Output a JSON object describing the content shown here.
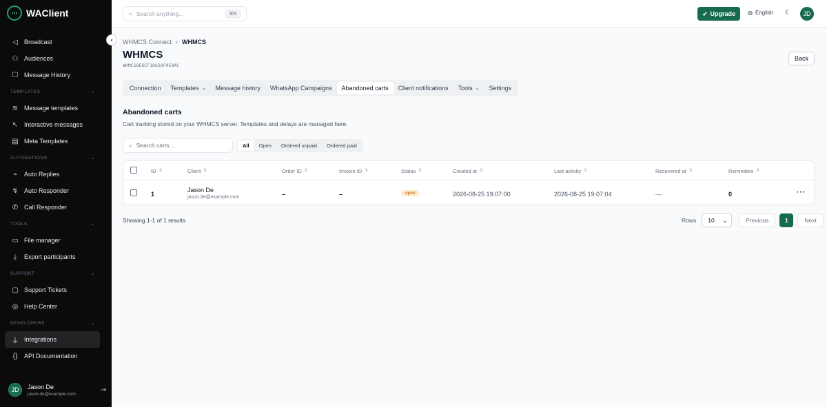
{
  "app": {
    "name": "WAClient"
  },
  "sidebar": {
    "items_top": [
      {
        "label": "Broadcast",
        "icon": "megaphone-icon"
      },
      {
        "label": "Audiences",
        "icon": "users-icon"
      },
      {
        "label": "Message History",
        "icon": "history-icon"
      }
    ],
    "sections": [
      {
        "label": "TEMPLATES",
        "items": [
          {
            "label": "Message templates",
            "icon": "layers-icon"
          },
          {
            "label": "Interactive messages",
            "icon": "cursor-icon"
          },
          {
            "label": "Meta Templates",
            "icon": "template-icon"
          }
        ]
      },
      {
        "label": "AUTOMATIONS",
        "items": [
          {
            "label": "Auto Replies",
            "icon": "reply-icon"
          },
          {
            "label": "Auto Responder",
            "icon": "responder-icon"
          },
          {
            "label": "Call Responder",
            "icon": "phone-icon"
          }
        ]
      },
      {
        "label": "TOOLS",
        "items": [
          {
            "label": "File manager",
            "icon": "folder-icon"
          },
          {
            "label": "Export participants",
            "icon": "download-icon"
          }
        ]
      },
      {
        "label": "SUPPORT",
        "items": [
          {
            "label": "Support Tickets",
            "icon": "ticket-icon"
          },
          {
            "label": "Help Center",
            "icon": "lifebuoy-icon"
          }
        ]
      },
      {
        "label": "DEVELOPERS",
        "items": [
          {
            "label": "Integrations",
            "icon": "plug-icon",
            "active": true
          },
          {
            "label": "API Documentation",
            "icon": "braces-icon"
          }
        ]
      }
    ],
    "user": {
      "initials": "JD",
      "name": "Jason De",
      "email": "jason.de@example.com"
    }
  },
  "topbar": {
    "search_placeholder": "Search anything...",
    "search_shortcut": "⌘K",
    "upgrade_label": "Upgrade",
    "language": "English",
    "avatar_initials": "JD"
  },
  "page": {
    "breadcrumb": [
      "WHMCS Connect",
      "WHMCS"
    ],
    "title": "WHMCS",
    "id": "WHMCS8E6EF18628F0E8AC",
    "back_label": "Back",
    "tabs": [
      {
        "label": "Connection"
      },
      {
        "label": "Templates",
        "dropdown": true
      },
      {
        "label": "Message history"
      },
      {
        "label": "WhatsApp Campaigns"
      },
      {
        "label": "Abandoned carts",
        "active": true
      },
      {
        "label": "Client notifications"
      },
      {
        "label": "Tools",
        "dropdown": true
      },
      {
        "label": "Settings"
      }
    ],
    "section_title": "Abandoned carts",
    "section_desc": "Cart tracking stored on your WHMCS server. Templates and delays are managed here.",
    "search_placeholder": "Search carts...",
    "filters": [
      "All",
      "Open",
      "Ordered unpaid",
      "Ordered paid"
    ],
    "table": {
      "columns": [
        "ID",
        "Client",
        "Order ID",
        "Invoice ID",
        "Status",
        "Created at",
        "Last activity",
        "Recovered at",
        "Reminders"
      ],
      "rows": [
        {
          "id": "1",
          "client_name": "Jason De",
          "client_email": "jason.de@example.com",
          "order_id": "–",
          "invoice_id": "–",
          "status": "open",
          "created_at": "2026-08-25 19:07:00",
          "last_activity": "2026-08-25 19:07:04",
          "recovered_at": "—",
          "reminders": "0"
        }
      ]
    },
    "showing": "Showing 1-1 of 1 results",
    "pager": {
      "rows_label": "Rows",
      "rows_value": "10",
      "previous": "Previous",
      "page": "1",
      "next": "Next"
    }
  }
}
